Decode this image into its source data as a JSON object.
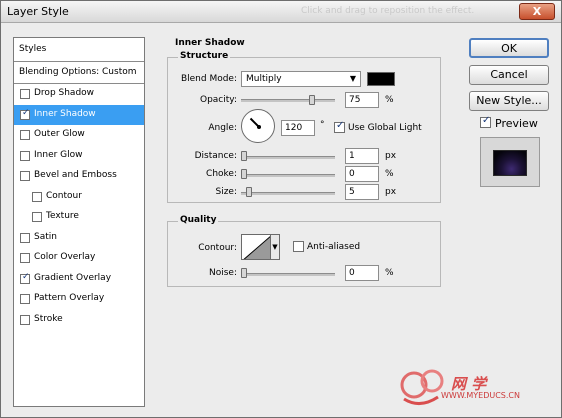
{
  "window": {
    "title": "Layer Style",
    "ghost_text": "Click and drag to reposition the effect.",
    "close_label": "X"
  },
  "styles": {
    "header": "Styles",
    "blending_options": "Blending Options: Custom",
    "items": [
      {
        "label": "Drop Shadow",
        "checked": false,
        "selected": false,
        "sub": false
      },
      {
        "label": "Inner Shadow",
        "checked": true,
        "selected": true,
        "sub": false
      },
      {
        "label": "Outer Glow",
        "checked": false,
        "selected": false,
        "sub": false
      },
      {
        "label": "Inner Glow",
        "checked": false,
        "selected": false,
        "sub": false
      },
      {
        "label": "Bevel and Emboss",
        "checked": false,
        "selected": false,
        "sub": false
      },
      {
        "label": "Contour",
        "checked": false,
        "selected": false,
        "sub": true
      },
      {
        "label": "Texture",
        "checked": false,
        "selected": false,
        "sub": true
      },
      {
        "label": "Satin",
        "checked": false,
        "selected": false,
        "sub": false
      },
      {
        "label": "Color Overlay",
        "checked": false,
        "selected": false,
        "sub": false
      },
      {
        "label": "Gradient Overlay",
        "checked": true,
        "selected": false,
        "sub": false
      },
      {
        "label": "Pattern Overlay",
        "checked": false,
        "selected": false,
        "sub": false
      },
      {
        "label": "Stroke",
        "checked": false,
        "selected": false,
        "sub": false
      }
    ]
  },
  "inner_shadow": {
    "section_title": "Inner Shadow",
    "structure": {
      "title": "Structure",
      "blend_mode_label": "Blend Mode:",
      "blend_mode_value": "Multiply",
      "shadow_color": "#000000",
      "opacity_label": "Opacity:",
      "opacity_value": "75",
      "opacity_unit": "%",
      "opacity_fraction": 0.75,
      "angle_label": "Angle:",
      "angle_value": "120",
      "angle_unit": "°",
      "use_global_light_label": "Use Global Light",
      "use_global_light_checked": true,
      "distance_label": "Distance:",
      "distance_value": "1",
      "distance_unit": "px",
      "choke_label": "Choke:",
      "choke_value": "0",
      "choke_unit": "%",
      "size_label": "Size:",
      "size_value": "5",
      "size_unit": "px"
    },
    "quality": {
      "title": "Quality",
      "contour_label": "Contour:",
      "anti_aliased_label": "Anti-aliased",
      "anti_aliased_checked": false,
      "noise_label": "Noise:",
      "noise_value": "0",
      "noise_unit": "%"
    }
  },
  "buttons": {
    "ok": "OK",
    "cancel": "Cancel",
    "new_style": "New Style...",
    "preview_label": "Preview",
    "preview_checked": true
  },
  "watermark": {
    "cn": "网 学",
    "url": "WWW.MYEDUCS.CN"
  },
  "colors": {
    "selection": "#3a9ef2",
    "default_button_border": "#4f7fc0"
  }
}
